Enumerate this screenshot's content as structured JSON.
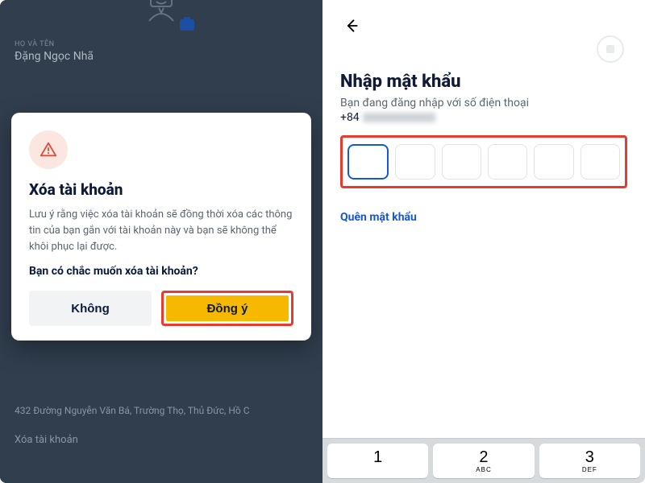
{
  "left": {
    "profile": {
      "field_label": "HỌ VÀ TÊN",
      "name": "Đặng Ngọc Nhã",
      "address": "432 Đường Nguyễn Văn Bá, Trường Thọ, Thủ Đức, Hồ C",
      "delete_link": "Xóa tài khoản"
    },
    "modal": {
      "title": "Xóa tài khoản",
      "body": "Lưu ý rằng việc xóa tài khoản sẽ đồng thời xóa các thông tin của bạn gắn với tài khoản này và bạn sẽ không thể khôi phục lại được.",
      "confirm": "Bạn có chắc muốn xóa tài khoản?",
      "no_label": "Không",
      "yes_label": "Đồng ý"
    }
  },
  "right": {
    "title": "Nhập mật khẩu",
    "subtitle": "Bạn đang đăng nhập với số điện thoại",
    "phone_prefix": "+84",
    "forgot": "Quên mật khẩu",
    "keys": [
      {
        "num": "1",
        "sub": ""
      },
      {
        "num": "2",
        "sub": "ABC"
      },
      {
        "num": "3",
        "sub": "DEF"
      }
    ]
  }
}
